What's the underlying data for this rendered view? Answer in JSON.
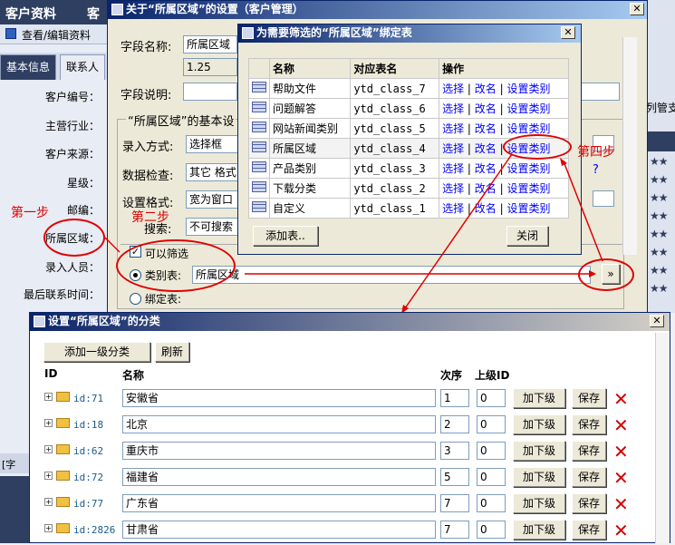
{
  "topbar": {
    "item1": "客户资料",
    "item2": "客"
  },
  "bg": {
    "title": "查看/编辑资料",
    "tab1": "基本信息",
    "tab2": "联系人",
    "labels": [
      "客户编号：",
      "主营行业：",
      "客户来源：",
      "星级：",
      "邮编：",
      "所属区域：",
      "录入人员：",
      "最后联系时间："
    ],
    "right_text": "列管支",
    "bottom_tab": "[字"
  },
  "field_win": {
    "title": "关于“所属区域”的设置（客户管理）",
    "name_label": "字段名称:",
    "name_value": "所属区域",
    "version_value": "1.25",
    "desc_label": "字段说明:",
    "group_label": "“所属区域”的基本设",
    "input_label": "录入方式:",
    "input_value": "选择框",
    "check_label": "数据检查:",
    "check_value": "其它 格式",
    "format_label": "设置格式:",
    "format_value": "宽为窗口",
    "search_label": "搜索:",
    "search_value": "不可搜索",
    "filterable": "可以筛选",
    "class_table_label": "类别表:",
    "class_table_value": "所属区域",
    "bind_label": "绑定表:",
    "more_btn": "»"
  },
  "bind_win": {
    "title": "为需要筛选的“所属区域”绑定表",
    "headers": [
      "名称",
      "对应表名",
      "操作"
    ],
    "rows": [
      {
        "name": "帮助文件",
        "table": "ytd_class_7"
      },
      {
        "name": "问题解答",
        "table": "ytd_class_6"
      },
      {
        "name": "网站新闻类别",
        "table": "ytd_class_5"
      },
      {
        "name": "所属区域",
        "table": "ytd_class_4"
      },
      {
        "name": "产品类别",
        "table": "ytd_class_3"
      },
      {
        "name": "下载分类",
        "table": "ytd_class_2"
      },
      {
        "name": "自定义",
        "table": "ytd_class_1"
      }
    ],
    "op_select": "选择",
    "op_rename": "改名",
    "op_set": "设置类别",
    "sep": "|",
    "add_btn": "添加表..",
    "close_btn": "关闭"
  },
  "annotations": {
    "step1": "第一步",
    "step2": "第二步",
    "step4": "第四步"
  },
  "class_win": {
    "title": "设置“所属区域”的分类",
    "add_btn": "添加一级分类",
    "refresh_btn": "刷新",
    "headers": {
      "id": "ID",
      "name": "名称",
      "order": "次序",
      "parent": "上级ID"
    },
    "rows": [
      {
        "id": "id:71",
        "name": "安徽省",
        "order": "1",
        "parent": "0"
      },
      {
        "id": "id:18",
        "name": "北京",
        "order": "2",
        "parent": "0"
      },
      {
        "id": "id:62",
        "name": "重庆市",
        "order": "3",
        "parent": "0"
      },
      {
        "id": "id:72",
        "name": "福建省",
        "order": "5",
        "parent": "0"
      },
      {
        "id": "id:77",
        "name": "广东省",
        "order": "7",
        "parent": "0"
      },
      {
        "id": "id:2826",
        "name": "甘肃省",
        "order": "7",
        "parent": "0"
      }
    ],
    "add_sub": "加下级",
    "save": "保存"
  },
  "colors": {
    "title_start": "#0a246a",
    "title_end": "#a6caf0",
    "annotation": "#e00000",
    "link": "#0000ff"
  }
}
